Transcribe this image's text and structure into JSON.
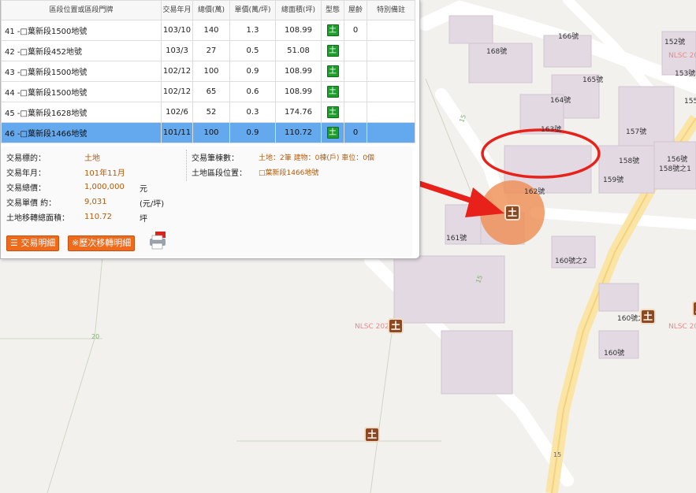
{
  "table": {
    "headers": [
      "區段位置或區段門牌",
      "交易年月",
      "總價(萬)",
      "單價(萬/坪)",
      "總面積(坪)",
      "型態",
      "屋齡",
      "特別備註"
    ],
    "rows": [
      {
        "address": "41 -□葉新段1500地號",
        "date": "103/10",
        "total": "140",
        "unit": "1.3",
        "area": "108.99",
        "type": "土",
        "age": "0",
        "note": ""
      },
      {
        "address": "42 -□葉新段452地號",
        "date": "103/3",
        "total": "27",
        "unit": "0.5",
        "area": "51.08",
        "type": "土",
        "age": "",
        "note": ""
      },
      {
        "address": "43 -□葉新段1500地號",
        "date": "102/12",
        "total": "100",
        "unit": "0.9",
        "area": "108.99",
        "type": "土",
        "age": "",
        "note": ""
      },
      {
        "address": "44 -□葉新段1500地號",
        "date": "102/12",
        "total": "65",
        "unit": "0.6",
        "area": "108.99",
        "type": "土",
        "age": "",
        "note": ""
      },
      {
        "address": "45 -□葉新段1628地號",
        "date": "102/6",
        "total": "52",
        "unit": "0.3",
        "area": "174.76",
        "type": "土",
        "age": "",
        "note": ""
      },
      {
        "address": "46 -□葉新段1466地號",
        "date": "101/11",
        "total": "100",
        "unit": "0.9",
        "area": "110.72",
        "type": "土",
        "age": "0",
        "note": "",
        "selected": true
      }
    ]
  },
  "detail": {
    "subject_label": "交易標的：",
    "subject_value": "土地",
    "month_label": "交易年月：",
    "month_value": "101年11月",
    "total_label": "交易總價：",
    "total_value": "1,000,000",
    "total_unit": "元",
    "unit_label": "交易單價 約：",
    "unit_value": "9,031",
    "unit_unit": "(元/坪)",
    "area_label": "土地移轉總面積：",
    "area_value": "110.72",
    "area_unit": "坪",
    "count_label": "交易筆棟數：",
    "count_value": "土地：2筆 建物：0棟(戶) 車位：0個",
    "location_label": "土地區段位置：",
    "location_value": "□葉新段1466地號"
  },
  "buttons": {
    "detail_label": "交易明細",
    "history_label": "※歷次移轉明細"
  },
  "map": {
    "labels": [
      {
        "id": "166",
        "text": "166號"
      },
      {
        "id": "152",
        "text": "152號"
      },
      {
        "id": "168",
        "text": "168號"
      },
      {
        "id": "165",
        "text": "165號"
      },
      {
        "id": "153",
        "text": "153號"
      },
      {
        "id": "164",
        "text": "164號"
      },
      {
        "id": "155",
        "text": "155"
      },
      {
        "id": "157",
        "text": "157號"
      },
      {
        "id": "163",
        "text": "163號"
      },
      {
        "id": "158",
        "text": "158號"
      },
      {
        "id": "156",
        "text": "156號"
      },
      {
        "id": "158z1",
        "text": "158號之1"
      },
      {
        "id": "159",
        "text": "159號"
      },
      {
        "id": "162",
        "text": "162號"
      },
      {
        "id": "161",
        "text": "161號"
      },
      {
        "id": "160z2",
        "text": "160號之2"
      },
      {
        "id": "160z3",
        "text": "160號之3"
      },
      {
        "id": "160",
        "text": "160號"
      }
    ],
    "road_numbers": [
      "15",
      "15",
      "20",
      "15"
    ],
    "watermark": "NLSC 2021",
    "marker_char": "土"
  },
  "colors": {
    "selected_row": "#64a8ee",
    "accent_orange": "#ef6a1b",
    "detail_value": "#b35b0b",
    "type_green": "#1e9d2c",
    "annotation_red": "#e8221a",
    "highlight_circle": "#ee8a4e"
  }
}
